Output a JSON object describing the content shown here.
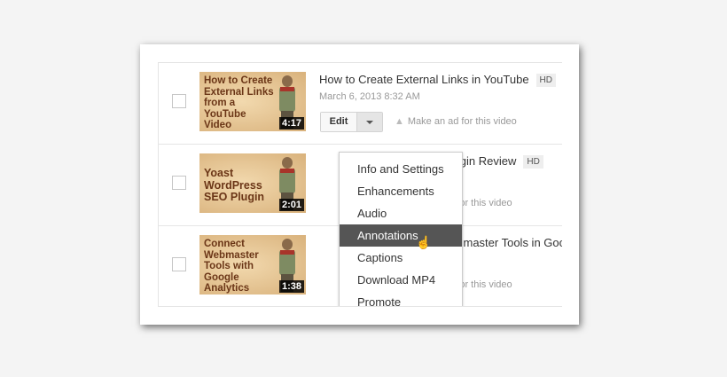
{
  "videos": [
    {
      "thumb_text": "How to Create\nExternal Links\nfrom a\nYouTube\nVideo",
      "duration": "4:17",
      "title": "How to Create External Links in YouTube",
      "hd": "HD",
      "date": "March 6, 2013 8:32 AM",
      "edit": "Edit",
      "ad": "Make an ad for this video"
    },
    {
      "thumb_text": "Yoast\nWordPress\nSEO Plugin",
      "duration": "2:01",
      "title_visible": "Plugin Review",
      "hd": "HD",
      "ad_visible": "ad for this video"
    },
    {
      "thumb_text": "Connect\nWebmaster\nTools with\nGoogle\nAnalytics",
      "duration": "1:38",
      "title_visible": "Webmaster Tools in Goo",
      "ad_visible": "ad for this video"
    }
  ],
  "menu": {
    "items": [
      "Info and Settings",
      "Enhancements",
      "Audio",
      "Annotations",
      "Captions",
      "Download MP4",
      "Promote"
    ],
    "selected": "Annotations"
  }
}
